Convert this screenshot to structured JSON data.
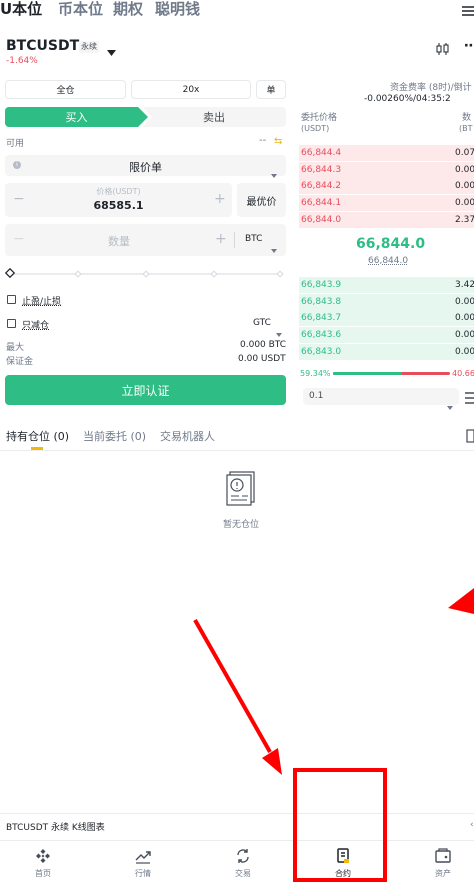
{
  "tabs": [
    "U本位",
    "币本位",
    "期权",
    "聪明钱"
  ],
  "header": {
    "symbol": "BTCUSDT",
    "tag": "永续",
    "change": "-1.64%"
  },
  "funding": {
    "label": "资金费率 (8时)/倒计",
    "value": "-0.00260%/04:35:2"
  },
  "controls": {
    "margin_mode": "全仓",
    "leverage": "20x",
    "position_mode": "单"
  },
  "side": {
    "buy": "买入",
    "sell": "卖出"
  },
  "available": {
    "label": "可用",
    "value": "--"
  },
  "order_type": "限价单",
  "price": {
    "label": "价格(USDT)",
    "value": "68585.1",
    "best": "最优价"
  },
  "qty": {
    "placeholder": "数量",
    "unit": "BTC"
  },
  "options": {
    "tpsl": "止盈/止损",
    "reduce": "只减仓",
    "tif": "GTC"
  },
  "max": {
    "label": "最大",
    "value": "0.000 BTC"
  },
  "margin": {
    "label": "保证金",
    "value": "0.00 USDT"
  },
  "cta": "立即认证",
  "book": {
    "price_header": "委托价格",
    "price_unit": "(USDT)",
    "qty_header": "数",
    "qty_unit": "(BT",
    "asks": [
      {
        "price": "66,844.4",
        "qty": "0.07"
      },
      {
        "price": "66,844.3",
        "qty": "0.00"
      },
      {
        "price": "66,844.2",
        "qty": "0.00"
      },
      {
        "price": "66,844.1",
        "qty": "0.00"
      },
      {
        "price": "66,844.0",
        "qty": "2.37"
      }
    ],
    "last": "66,844.0",
    "mark": "66,844.0",
    "bids": [
      {
        "price": "66,843.9",
        "qty": "3.42"
      },
      {
        "price": "66,843.8",
        "qty": "0.00"
      },
      {
        "price": "66,843.7",
        "qty": "0.00"
      },
      {
        "price": "66,843.6",
        "qty": "0.00"
      },
      {
        "price": "66,843.0",
        "qty": "0.00"
      }
    ],
    "buy_ratio": "59.34%",
    "sell_ratio": "40.66",
    "buy_ratio_value": 59.34,
    "precision": "0.1"
  },
  "positions_tabs": [
    "持有仓位 (0)",
    "当前委托 (0)",
    "交易机器人"
  ],
  "empty_text": "暂无仓位",
  "chart_bar": "BTCUSDT 永续 K线图表",
  "nav": [
    "首页",
    "行情",
    "交易",
    "合约",
    "资产"
  ],
  "colors": {
    "green": "#2ebd85",
    "red": "#e84d5b",
    "annotation": "#ff0000"
  }
}
